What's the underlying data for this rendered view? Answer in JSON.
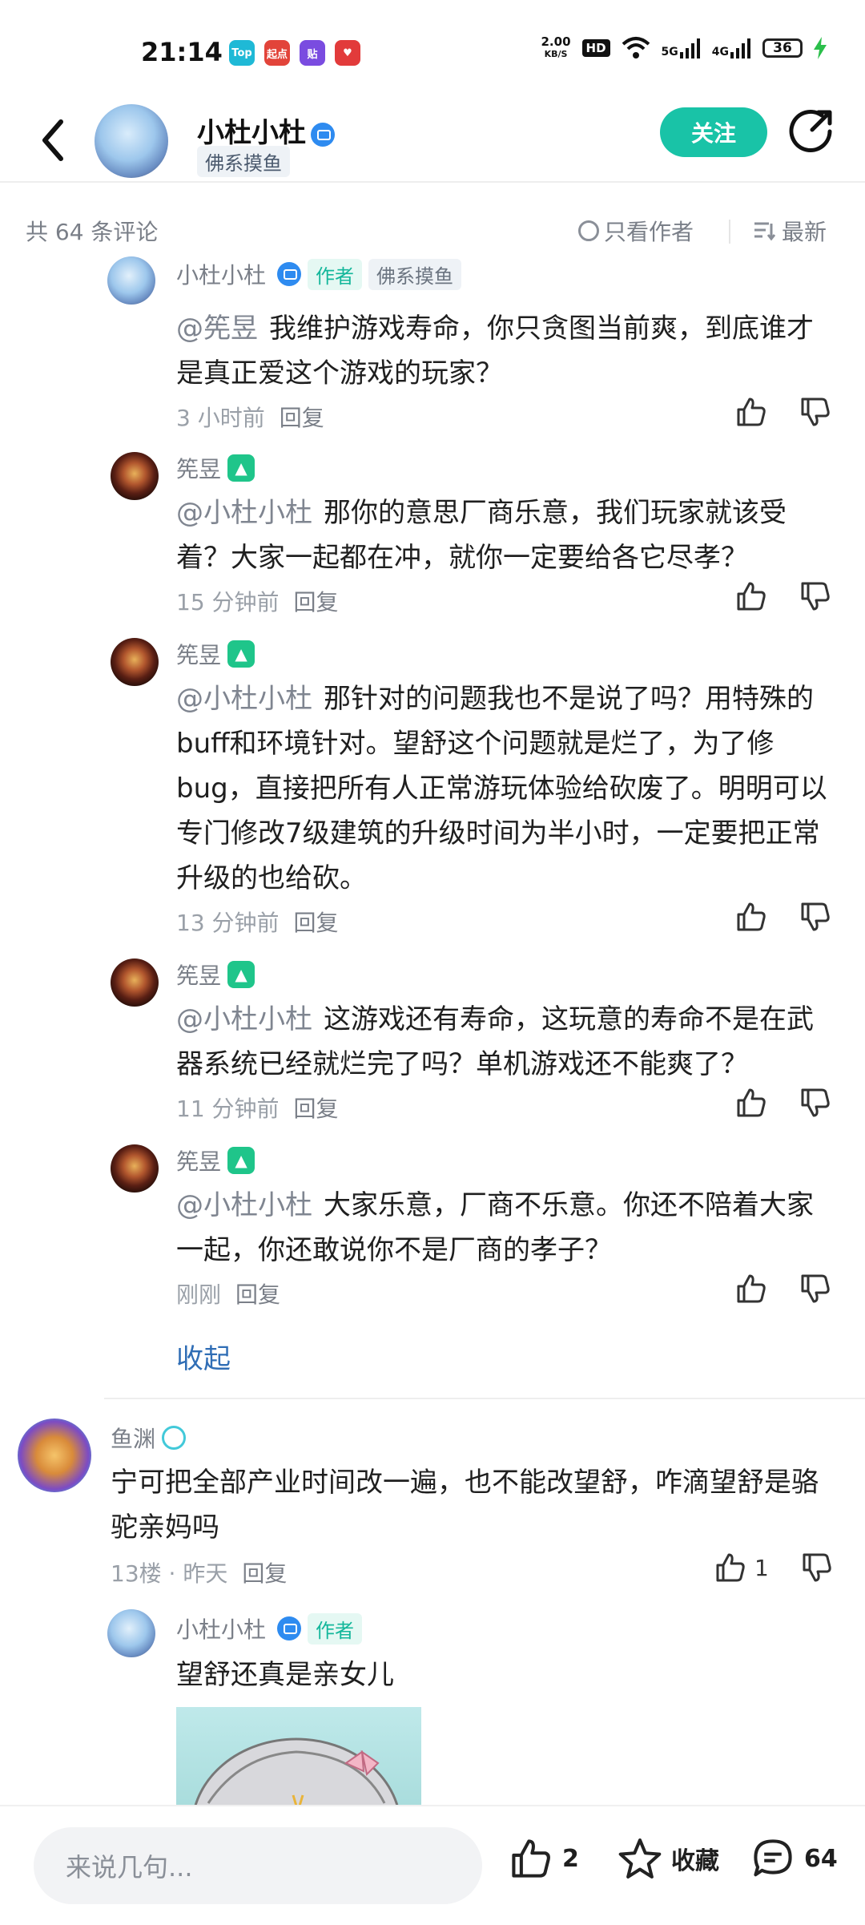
{
  "status": {
    "time": "21:14",
    "net_speed_value": "2.00",
    "net_speed_unit": "KB/S",
    "hd": "HD",
    "sim1": "5G",
    "sim2": "4G",
    "battery": "36",
    "apps": [
      {
        "label": "Top",
        "color": "#1fb9d6"
      },
      {
        "label": "起点",
        "color": "#e2443a"
      },
      {
        "label": "贴",
        "color": "#7a4ce0"
      },
      {
        "label": "♥",
        "color": "#e23b3b"
      }
    ]
  },
  "header": {
    "name": "小杜小杜",
    "tag": "佛系摸鱼",
    "follow": "关注"
  },
  "filter": {
    "count": "共 64 条评论",
    "only_author": "只看作者",
    "latest": "最新"
  },
  "comments": [
    {
      "user": "小杜小杜",
      "badge_author": "作者",
      "badge_tag": "佛系摸鱼",
      "mention": "@筅昱",
      "text": "我维护游戏寿命，你只贪图当前爽，到底谁才是真正爱这个游戏的玩家？",
      "time": "3 小时前",
      "reply": "回复"
    },
    {
      "user": "筅昱",
      "mention": "@小杜小杜",
      "text": "那你的意思厂商乐意，我们玩家就该受着？大家一起都在冲，就你一定要给各它尽孝？",
      "time": "15 分钟前",
      "reply": "回复"
    },
    {
      "user": "筅昱",
      "mention": "@小杜小杜",
      "text": "那针对的问题我也不是说了吗？用特殊的buff和环境针对。望舒这个问题就是烂了，为了修bug，直接把所有人正常游玩体验给砍废了。明明可以专门修改7级建筑的升级时间为半小时，一定要把正常升级的也给砍。",
      "time": "13 分钟前",
      "reply": "回复"
    },
    {
      "user": "筅昱",
      "mention": "@小杜小杜",
      "text": "这游戏还有寿命，这玩意的寿命不是在武器系统已经就烂完了吗？单机游戏还不能爽了？",
      "time": "11 分钟前",
      "reply": "回复"
    },
    {
      "user": "筅昱",
      "mention": "@小杜小杜",
      "text": "大家乐意，厂商不乐意。你还不陪着大家一起，你还敢说你不是厂商的孝子？",
      "time": "刚刚",
      "reply": "回复"
    }
  ],
  "collapse": "收起",
  "floor": {
    "user": "鱼渊",
    "text": "宁可把全部产业时间改一遍，也不能改望舒，咋滴望舒是骆驼亲妈吗",
    "floor_time": "13楼 · 昨天",
    "reply": "回复",
    "likes": "1"
  },
  "floor_reply": {
    "user": "小杜小杜",
    "badge_author": "作者",
    "text": "望舒还真是亲女儿"
  },
  "bottom": {
    "placeholder": "来说几句...",
    "likes": "2",
    "collect": "收藏",
    "comments": "64"
  }
}
